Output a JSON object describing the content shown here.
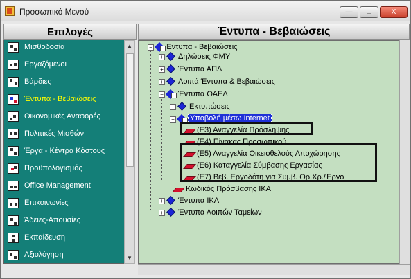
{
  "window": {
    "title": "Προσωπικό Μενού",
    "controls": {
      "minimize": "—",
      "maximize": "□",
      "close": "X"
    }
  },
  "left_panel": {
    "header": "Επιλογές",
    "items": [
      {
        "label": "Μισθοδοσία",
        "icon": "payroll-icon",
        "active": false
      },
      {
        "label": "Εργαζόμενοι",
        "icon": "employees-icon",
        "active": false
      },
      {
        "label": "Βάρδιες",
        "icon": "shifts-icon",
        "active": false
      },
      {
        "label": "Έντυπα - Βεβαιώσεις",
        "icon": "forms-icon",
        "active": true
      },
      {
        "label": "Οικονομικές Αναφορές",
        "icon": "financial-reports-icon",
        "active": false
      },
      {
        "label": "Πολιτικές Μισθών",
        "icon": "wage-policy-icon",
        "active": false
      },
      {
        "label": "Έργα - Κέντρα Κόστους",
        "icon": "projects-icon",
        "active": false
      },
      {
        "label": "Προϋπολογισμός",
        "icon": "budget-icon",
        "active": false
      },
      {
        "label": "Office Management",
        "icon": "office-icon",
        "active": false
      },
      {
        "label": "Επικοινωνίες",
        "icon": "communications-icon",
        "active": false
      },
      {
        "label": "Άδειες-Απουσίες",
        "icon": "leave-icon",
        "active": false
      },
      {
        "label": "Εκπαίδευση",
        "icon": "training-icon",
        "active": false
      },
      {
        "label": "Αξιολόγηση",
        "icon": "evaluation-icon",
        "active": false
      }
    ]
  },
  "right_panel": {
    "header": "Έντυπα - Βεβαιώσεις",
    "tree": {
      "root": "Έντυπα - Βεβαιώσεις",
      "nodes": [
        "Δηλώσεις ΦΜΥ",
        "Έντυπα ΑΠΔ",
        "Λοιπά Έντυπα & Βεβαιώσεις",
        "Έντυπα ΟΑΕΔ",
        "Εκτυπώσεις",
        "Υποβολή μέσω Internet",
        "(Ε3) Αναγγελία Πρόσληψης",
        "(Ε4) Πίνακας Προσωπικού",
        "(Ε5) Αναγγελία Οικειοθελούς Αποχώρησης",
        "(Ε6) Καταγγελία Σύμβασης Εργασίας",
        "(Ε7) Βεβ. Εργοδότη για Συμβ. Ορ.Χρ./Έργο",
        "Κωδικός Πρόσβασης ΙΚΑ",
        "Έντυπα ΙΚΑ",
        "Έντυπα Λοιπών Ταμείων"
      ]
    }
  },
  "colors": {
    "left_panel_bg": "#147f78",
    "tree_bg": "#c4dfc1",
    "selection": "#1f31d7",
    "highlight_box": "#111111",
    "active_menu_text": "#ffff00"
  }
}
